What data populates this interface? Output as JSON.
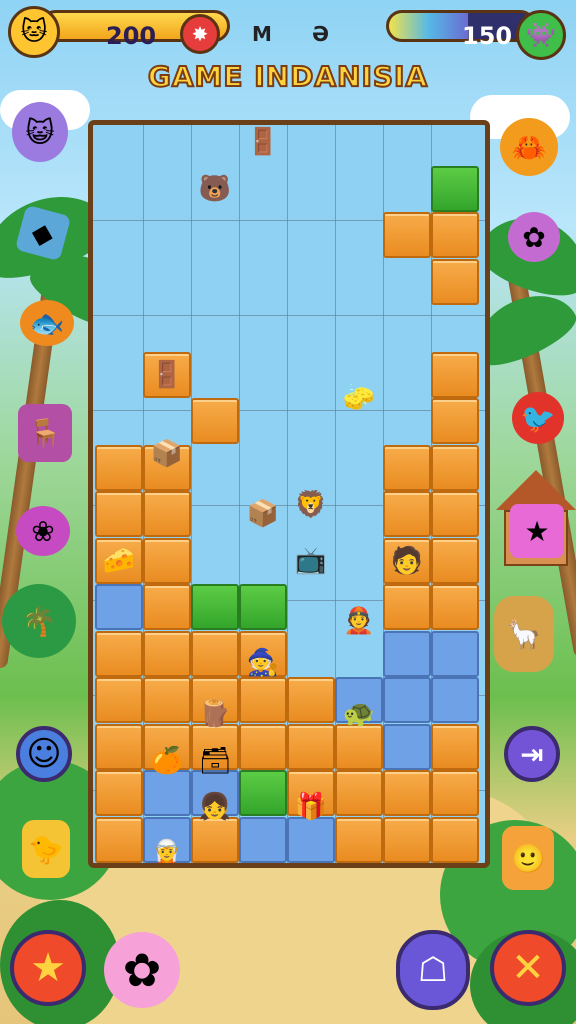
{
  "hud": {
    "coins": "200",
    "energy": "150",
    "energy_fill": 0.55,
    "letter_left": "M",
    "letter_right": "Ə",
    "mascot_icon": "cat-face-icon",
    "alert_icon": "splat-icon",
    "monster_icon": "green-monster-icon"
  },
  "title": "GAME INDANISIA",
  "colors": {
    "orange_tile": "#f0a03a",
    "blue_tile": "#6ea1e6",
    "green_tile": "#3fb534",
    "board_frame": "#6b3f17",
    "title_fill": "#ffd23f"
  },
  "controls": {
    "left_top_icon": "smiley-button-icon",
    "right_top_icon": "exit-arrow-button-icon",
    "bottom_left_icon": "star-button-icon",
    "bottom_mid_icon": "ghost-button-icon",
    "bottom_right_icon": "close-x-button-icon"
  }
}
